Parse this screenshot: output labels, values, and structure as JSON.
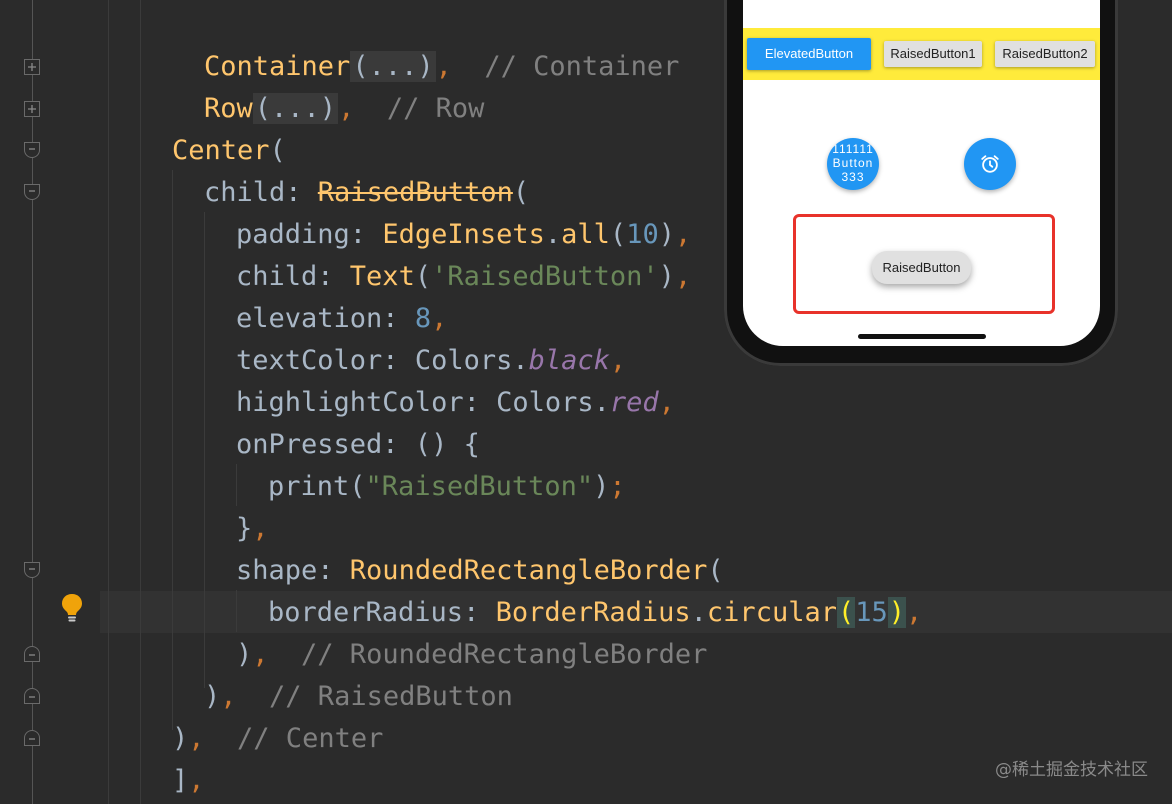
{
  "code": {
    "lines": [
      {
        "parts": [
          {
            "t": "Container",
            "c": "cl"
          },
          {
            "t": "(...)",
            "c": "fold-box"
          },
          {
            "t": ",",
            "c": "kw"
          },
          {
            "t": "  // Container",
            "c": "cm"
          }
        ]
      },
      {
        "parts": [
          {
            "t": "Row",
            "c": "cl"
          },
          {
            "t": "(...)",
            "c": "fold-box"
          },
          {
            "t": ",",
            "c": "kw"
          },
          {
            "t": "  // Row",
            "c": "cm"
          }
        ]
      },
      {
        "parts": [
          {
            "t": "Center",
            "c": "cl"
          },
          {
            "t": "(",
            "c": "pl"
          }
        ]
      },
      {
        "parts": [
          {
            "t": "child: ",
            "c": "pl"
          },
          {
            "t": "RaisedButton",
            "c": "dep"
          },
          {
            "t": "(",
            "c": "pl"
          }
        ]
      },
      {
        "parts": [
          {
            "t": "padding: ",
            "c": "pl"
          },
          {
            "t": "EdgeInsets",
            "c": "cl"
          },
          {
            "t": ".",
            "c": "pl"
          },
          {
            "t": "all",
            "c": "cl"
          },
          {
            "t": "(",
            "c": "pl"
          },
          {
            "t": "10",
            "c": "nm"
          },
          {
            "t": ")",
            "c": "pl"
          },
          {
            "t": ",",
            "c": "kw"
          }
        ]
      },
      {
        "parts": [
          {
            "t": "child: ",
            "c": "pl"
          },
          {
            "t": "Text",
            "c": "cl"
          },
          {
            "t": "(",
            "c": "pl"
          },
          {
            "t": "'RaisedButton'",
            "c": "st"
          },
          {
            "t": ")",
            "c": "pl"
          },
          {
            "t": ",",
            "c": "kw"
          }
        ]
      },
      {
        "parts": [
          {
            "t": "elevation: ",
            "c": "pl"
          },
          {
            "t": "8",
            "c": "nm"
          },
          {
            "t": ",",
            "c": "kw"
          }
        ]
      },
      {
        "parts": [
          {
            "t": "textColor: ",
            "c": "pl"
          },
          {
            "t": "Colors.",
            "c": "pl"
          },
          {
            "t": "black",
            "c": "it"
          },
          {
            "t": ",",
            "c": "kw"
          }
        ]
      },
      {
        "parts": [
          {
            "t": "highlightColor: ",
            "c": "pl"
          },
          {
            "t": "Colors.",
            "c": "pl"
          },
          {
            "t": "red",
            "c": "it"
          },
          {
            "t": ",",
            "c": "kw"
          }
        ]
      },
      {
        "parts": [
          {
            "t": "onPressed: () {",
            "c": "pl"
          }
        ]
      },
      {
        "parts": [
          {
            "t": "print(",
            "c": "pl"
          },
          {
            "t": "\"RaisedButton\"",
            "c": "st"
          },
          {
            "t": ")",
            "c": "pl"
          },
          {
            "t": ";",
            "c": "kw"
          }
        ]
      },
      {
        "parts": [
          {
            "t": "}",
            "c": "pl"
          },
          {
            "t": ",",
            "c": "kw"
          }
        ]
      },
      {
        "parts": [
          {
            "t": "shape: ",
            "c": "pl"
          },
          {
            "t": "RoundedRectangleBorder",
            "c": "cl"
          },
          {
            "t": "(",
            "c": "pl"
          }
        ]
      },
      {
        "parts": [
          {
            "t": "borderRadius: ",
            "c": "pl"
          },
          {
            "t": "BorderRadius",
            "c": "cl"
          },
          {
            "t": ".",
            "c": "pl"
          },
          {
            "t": "circular",
            "c": "cl"
          },
          {
            "t": "(",
            "c": "bracket-highlight"
          },
          {
            "t": "15",
            "c": "nm"
          },
          {
            "t": ")",
            "c": "bracket-highlight"
          },
          {
            "t": ",",
            "c": "kw"
          }
        ]
      },
      {
        "parts": [
          {
            "t": ")",
            "c": "pl"
          },
          {
            "t": ",",
            "c": "kw"
          },
          {
            "t": "  // RoundedRectangleBorder",
            "c": "cm"
          }
        ]
      },
      {
        "parts": [
          {
            "t": ")",
            "c": "pl"
          },
          {
            "t": ",",
            "c": "kw"
          },
          {
            "t": "  // RaisedButton",
            "c": "cm"
          }
        ]
      },
      {
        "parts": [
          {
            "t": ")",
            "c": "pl"
          },
          {
            "t": ",",
            "c": "kw"
          },
          {
            "t": "  // Center",
            "c": "cm"
          }
        ]
      },
      {
        "parts": [
          {
            "t": "]",
            "c": "pl"
          },
          {
            "t": ",",
            "c": "kw"
          }
        ]
      }
    ]
  },
  "phone": {
    "elevated_button": "ElevatedButton",
    "raised_button_1": "RaisedButton1",
    "raised_button_2": "RaisedButton2",
    "fab_text_line1": "111111",
    "fab_text_line2": "Button",
    "fab_text_line3": "333",
    "raised_button_main": "RaisedButton"
  },
  "icons": {
    "fab_icon": "alarm-clock-icon",
    "lightbulb": "lightbulb-icon"
  },
  "colors": {
    "editor_bg": "#2b2b2b",
    "accent_blue": "#2196f3",
    "yellow_bar": "#ffeb3b",
    "highlight_red": "#e8322a"
  },
  "watermark": "@稀土掘金技术社区"
}
